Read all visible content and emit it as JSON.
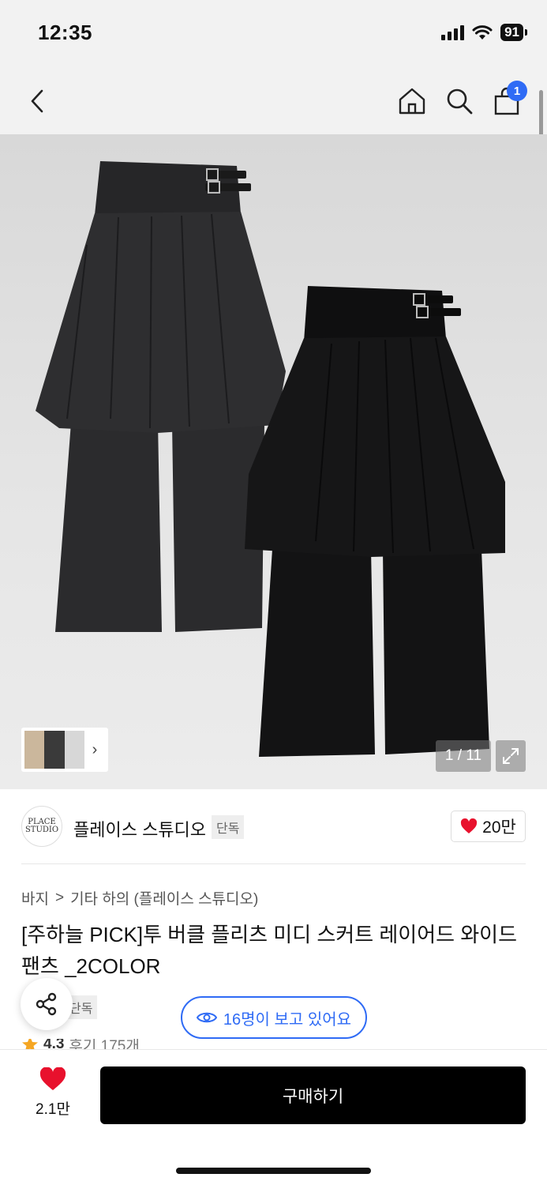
{
  "status_bar": {
    "time": "12:35",
    "battery": "91"
  },
  "header": {
    "cart_count": "1"
  },
  "gallery": {
    "page_counter": "1 / 11"
  },
  "brand": {
    "logo_text": "PLACE STUDIO",
    "name": "플레이스 스튜디오",
    "badge": "단독",
    "like_count": "20만"
  },
  "breadcrumb": {
    "category": "바지",
    "separator": ">",
    "subcategory": "기타 하의 (플레이스 스튜디오)"
  },
  "product": {
    "title": "[주하늘 PICK]투 버클 플리츠 미디 스커트 레이어드 와이드 팬츠 _2COLOR",
    "tag": "단독",
    "rating": "4.3",
    "review_label": "후기 175개"
  },
  "floating": {
    "viewers": "16명이 보고 있어요"
  },
  "bottom_bar": {
    "wish_count": "2.1만",
    "buy_label": "구매하기"
  },
  "colors": {
    "accent_blue": "#2f6bf5",
    "heart_red": "#e8112d",
    "star_orange": "#f5a623",
    "buy_black": "#000000"
  }
}
